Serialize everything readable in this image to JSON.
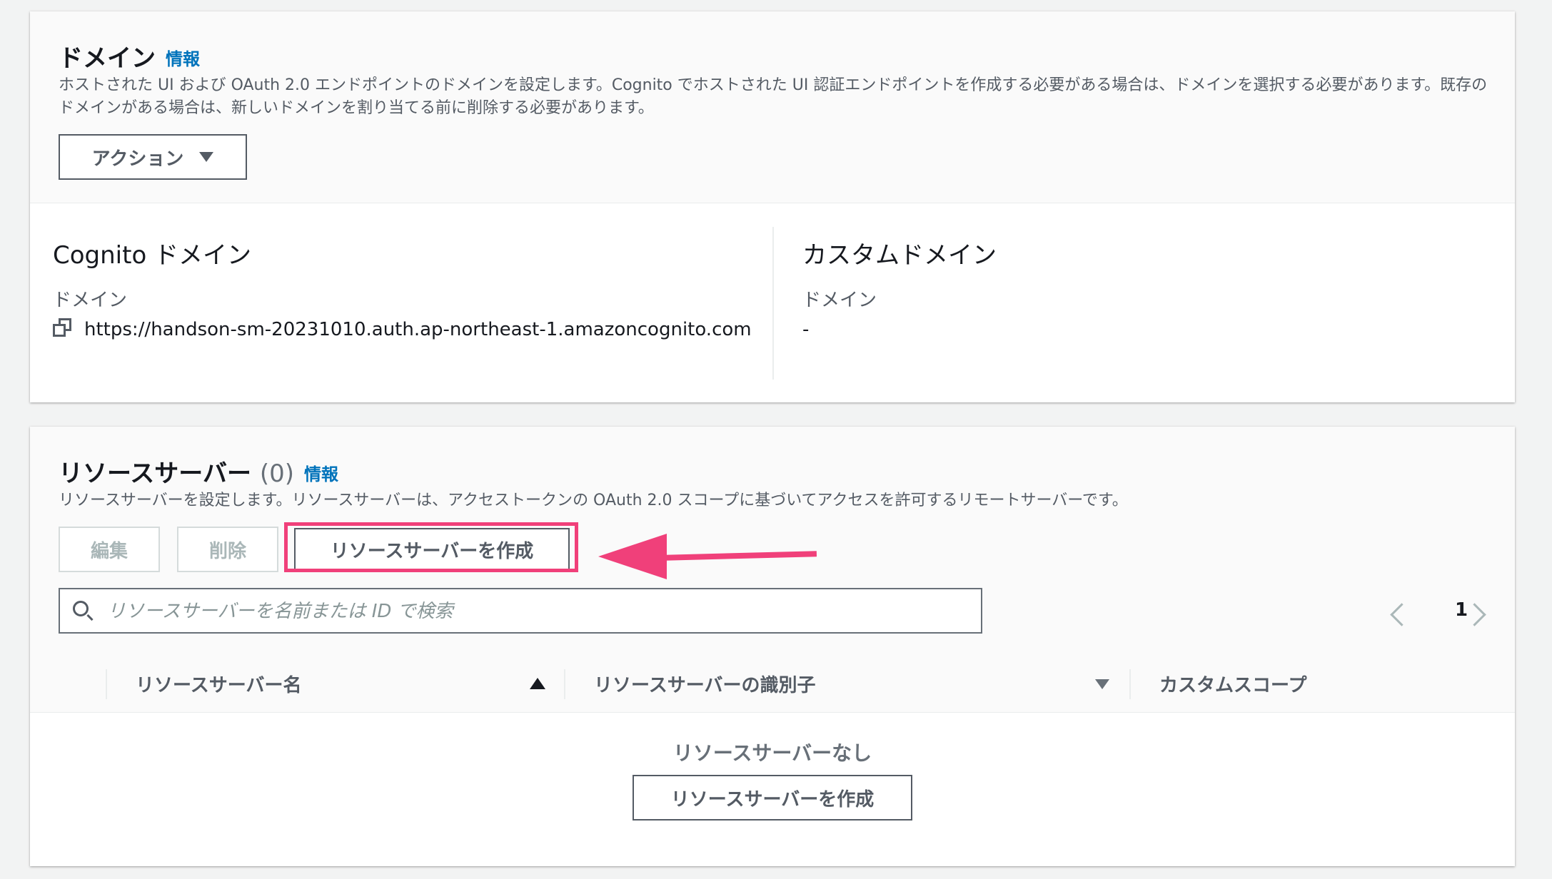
{
  "domain_section": {
    "title": "ドメイン",
    "info_link": "情報",
    "description": "ホストされた UI および OAuth 2.0 エンドポイントのドメインを設定します。Cognito でホストされた UI 認証エンドポイントを作成する必要がある場合は、ドメインを選択する必要があります。既存のドメインがある場合は、新しいドメインを割り当てる前に削除する必要があります。",
    "actions_button": "アクション",
    "cognito_domain": {
      "title": "Cognito ドメイン",
      "label": "ドメイン",
      "value": "https://handson-sm-20231010.auth.ap-northeast-1.amazoncognito.com"
    },
    "custom_domain": {
      "title": "カスタムドメイン",
      "label": "ドメイン",
      "value": "-"
    }
  },
  "resource_servers": {
    "title": "リソースサーバー",
    "count": "(0)",
    "info_link": "情報",
    "description": "リソースサーバーを設定します。リソースサーバーは、アクセストークンの OAuth 2.0 スコープに基づいてアクセスを許可するリモートサーバーです。",
    "buttons": {
      "edit": "編集",
      "delete": "削除",
      "create": "リソースサーバーを作成"
    },
    "search": {
      "placeholder": "リソースサーバーを名前または ID で検索",
      "value": ""
    },
    "pagination": {
      "current_page": "1"
    },
    "columns": [
      "リソースサーバー名",
      "リソースサーバーの識別子",
      "カスタムスコープ"
    ],
    "empty_state": {
      "message": "リソースサーバーなし",
      "create_button": "リソースサーバーを作成"
    }
  },
  "annotation": {
    "color": "#f0407a"
  }
}
